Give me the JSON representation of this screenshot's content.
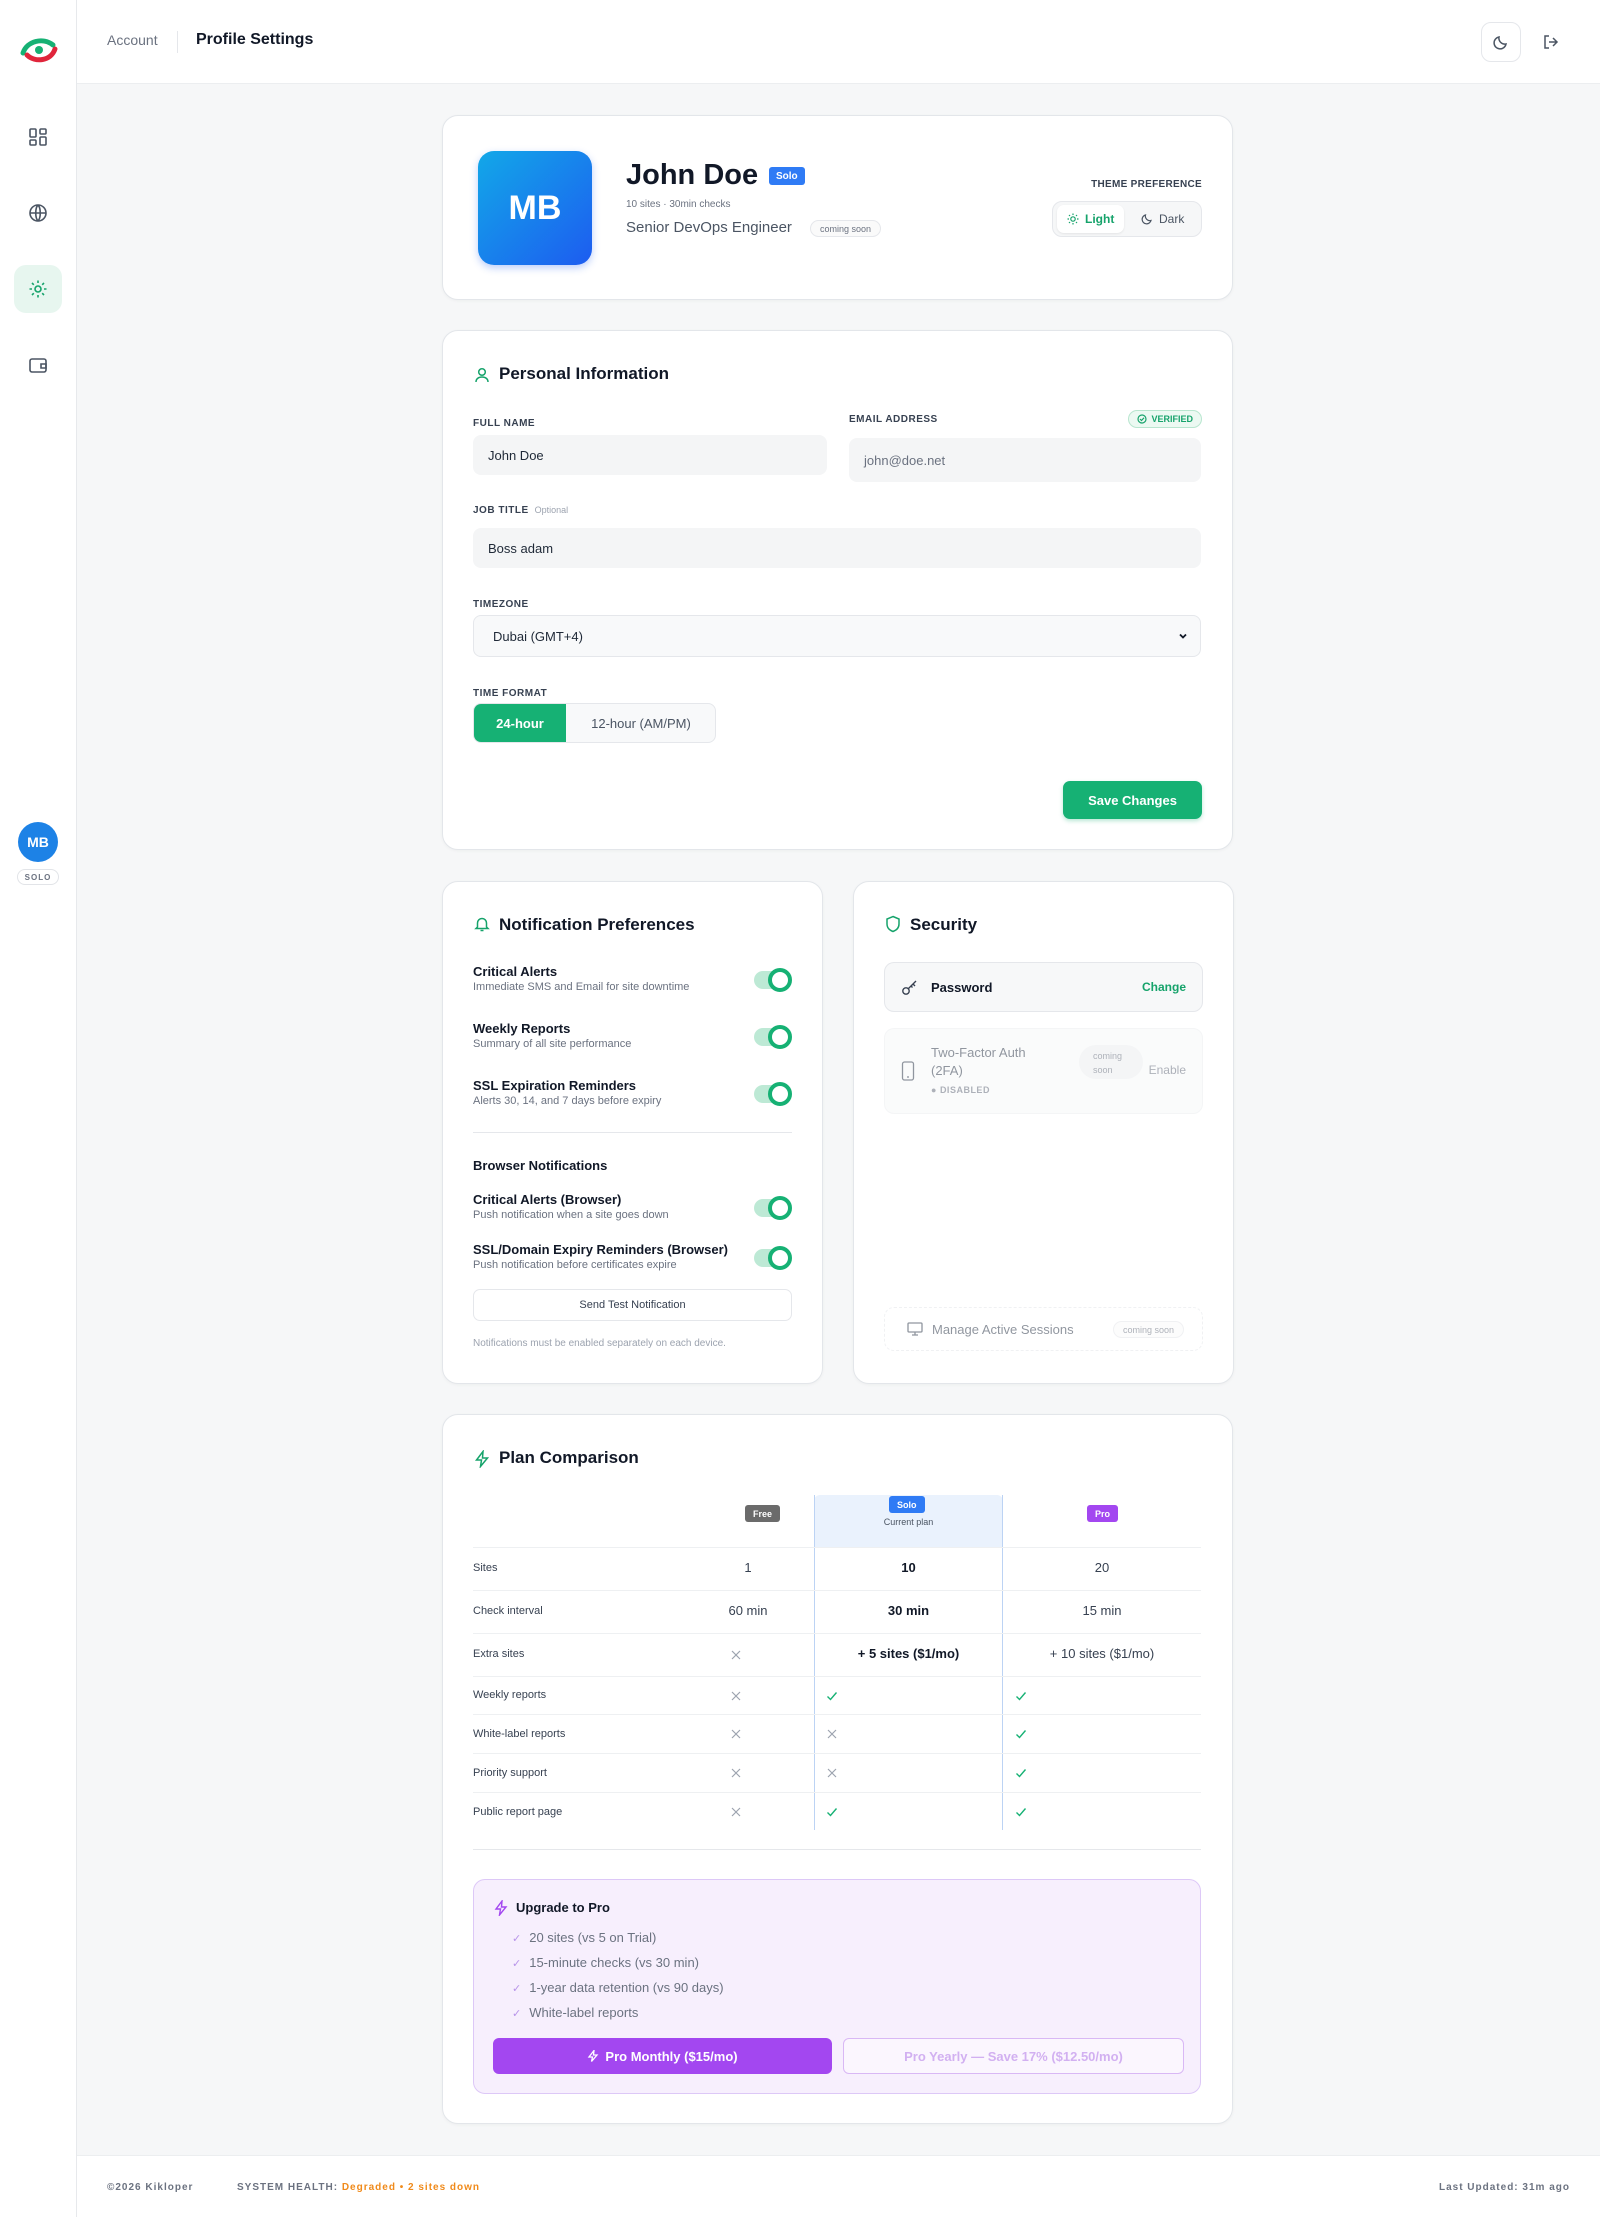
{
  "header": {
    "breadcrumb_parent": "Account",
    "breadcrumb_current": "Profile Settings"
  },
  "sidebar": {
    "avatar_initials": "MB",
    "plan_badge": "SOLO",
    "icons": [
      "dashboard-icon",
      "globe-icon",
      "gear-icon",
      "wallet-icon"
    ]
  },
  "profile": {
    "initials": "MB",
    "name": "John Doe",
    "plan": "Solo",
    "meta": "10 sites · 30min checks",
    "job_title": "Senior DevOps Engineer",
    "coming_soon": "coming soon",
    "theme_label": "THEME PREFERENCE",
    "theme_light": "Light",
    "theme_dark": "Dark"
  },
  "personal": {
    "title": "Personal Information",
    "full_name_label": "FULL NAME",
    "full_name_value": "John Doe",
    "email_label": "EMAIL ADDRESS",
    "email_value": "john@doe.net",
    "verified": "VERIFIED",
    "job_label": "JOB TITLE",
    "job_optional": "Optional",
    "job_value": "Boss adam",
    "timezone_label": "TIMEZONE",
    "timezone_value": "Dubai (GMT+4)",
    "time_format_label": "TIME FORMAT",
    "format_24": "24-hour",
    "format_12": "12-hour (AM/PM)",
    "save": "Save Changes"
  },
  "notifications": {
    "title": "Notification Preferences",
    "items": [
      {
        "title": "Critical Alerts",
        "desc": "Immediate SMS and Email for site downtime"
      },
      {
        "title": "Weekly Reports",
        "desc": "Summary of all site performance"
      },
      {
        "title": "SSL Expiration Reminders",
        "desc": "Alerts 30, 14, and 7 days before expiry"
      }
    ],
    "browser_title": "Browser Notifications",
    "browser_items": [
      {
        "title": "Critical Alerts (Browser)",
        "desc": "Push notification when a site goes down"
      },
      {
        "title": "SSL/Domain Expiry Reminders (Browser)",
        "desc": "Push notification before certificates expire"
      }
    ],
    "test_button": "Send Test Notification",
    "footnote": "Notifications must be enabled separately on each device."
  },
  "security": {
    "title": "Security",
    "password_label": "Password",
    "change": "Change",
    "twofa_label_1": "Two-Factor Auth",
    "twofa_label_2": "(2FA)",
    "twofa_status": "DISABLED",
    "coming_1": "coming",
    "coming_2": "soon",
    "enable": "Enable",
    "sessions_label": "Manage Active Sessions",
    "sessions_soon": "coming soon"
  },
  "plans": {
    "title": "Plan Comparison",
    "free": "Free",
    "solo": "Solo",
    "pro": "Pro",
    "current_plan": "Current plan",
    "rows": [
      {
        "label": "Sites",
        "free": "1",
        "solo": "10",
        "pro": "20"
      },
      {
        "label": "Check interval",
        "free": "60 min",
        "solo": "30 min",
        "pro": "15 min"
      },
      {
        "label": "Extra sites",
        "free": "",
        "solo": "+ 5 sites ($1/mo)",
        "pro": "+ 10 sites ($1/mo)"
      },
      {
        "label": "Weekly reports"
      },
      {
        "label": "White-label reports"
      },
      {
        "label": "Priority support"
      },
      {
        "label": "Public report page"
      }
    ],
    "upgrade_title": "Upgrade to Pro",
    "upgrade_items": [
      "20 sites (vs 5 on Trial)",
      "15-minute checks (vs 30 min)",
      "1-year data retention (vs 90 days)",
      "White-label reports"
    ],
    "pro_monthly": "Pro Monthly ($15/mo)",
    "pro_yearly": "Pro Yearly — Save 17% ($12.50/mo)"
  },
  "footer": {
    "copyright": "©2026 Kikloper",
    "health_label": "SYSTEM HEALTH:",
    "health_status": "Degraded",
    "sites_down": "2 sites down",
    "last_updated": "Last Updated: 31m ago"
  },
  "colors": {
    "accent": "#16b174",
    "pro": "#a347f0",
    "solo": "#2f7bf5",
    "warning": "#f08a1a"
  }
}
